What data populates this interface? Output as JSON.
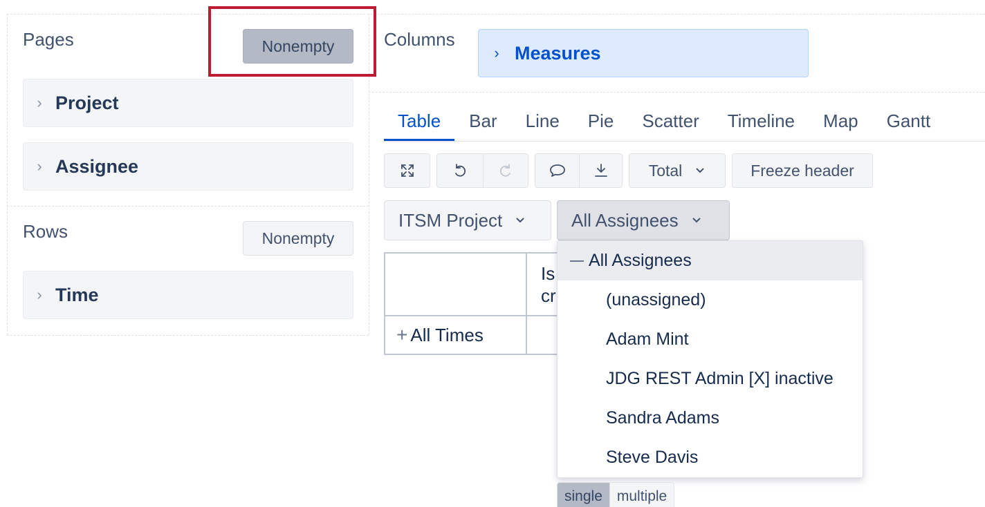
{
  "pages": {
    "title": "Pages",
    "nonempty_label": "Nonempty",
    "dimensions": [
      "Project",
      "Assignee"
    ]
  },
  "rows": {
    "title": "Rows",
    "nonempty_label": "Nonempty",
    "dimensions": [
      "Time"
    ]
  },
  "columns": {
    "title": "Columns",
    "dimensions": [
      "Measures"
    ]
  },
  "tabs": [
    "Table",
    "Bar",
    "Line",
    "Pie",
    "Scatter",
    "Timeline",
    "Map",
    "Gantt"
  ],
  "active_tab": "Table",
  "toolbar": {
    "total_label": "Total",
    "freeze_label": "Freeze header"
  },
  "filters": {
    "project": "ITSM Project",
    "assignee": "All Assignees"
  },
  "table": {
    "header_partial": [
      "Is",
      "cr"
    ],
    "row_header": "All Times"
  },
  "assignee_dropdown": {
    "root": "All Assignees",
    "items": [
      "(unassigned)",
      "Adam Mint",
      "JDG REST Admin [X] inactive",
      "Sandra Adams",
      "Steve Davis"
    ]
  },
  "selection_mode": {
    "single": "single",
    "multiple": "multiple",
    "active": "single"
  },
  "colors": {
    "accent": "#0052cc",
    "highlight": "#c01a32"
  }
}
